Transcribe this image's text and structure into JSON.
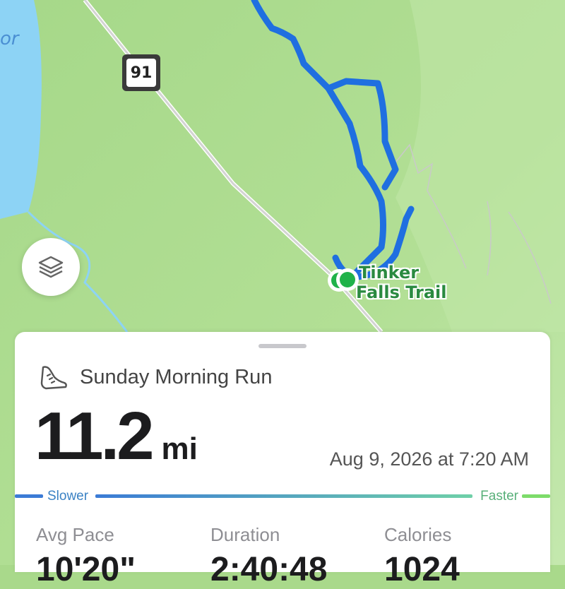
{
  "map": {
    "lake_label": "or",
    "highway_shield": "91",
    "trailhead_label_line1": "Tinker",
    "trailhead_label_line2": "Falls Trail",
    "colors": {
      "land": "#a9d98b",
      "water": "#8dd3f5",
      "route": "#1f6fe0",
      "marker": "#20b24a"
    }
  },
  "layers_button": {
    "icon": "layers-icon"
  },
  "activity": {
    "icon": "running-shoe-icon",
    "title": "Sunday Morning Run",
    "distance_value": "11.2",
    "distance_unit": "mi",
    "date": "Aug 9, 2026 at 7:20 AM"
  },
  "pace_scale": {
    "slower_label": "Slower",
    "faster_label": "Faster",
    "colors": {
      "slower": "#3b7bd6",
      "faster": "#7ddc6a"
    }
  },
  "stats": [
    {
      "label": "Avg Pace",
      "value": "10'20\""
    },
    {
      "label": "Duration",
      "value": "2:40:48"
    },
    {
      "label": "Calories",
      "value": "1024"
    }
  ]
}
